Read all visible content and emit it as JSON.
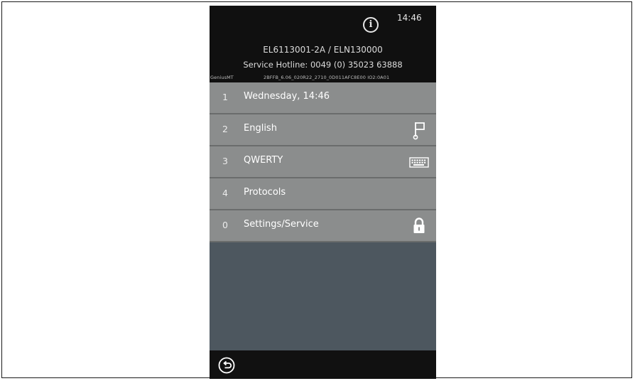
{
  "header": {
    "clock": "14:46",
    "model": "EL6113001-2A / ELN130000",
    "hotline": "Service Hotline: 0049 (0) 35023 63888",
    "device_name": "GeniusMT",
    "firmware": "2BFFB_6.06_020R22_2710_0D011AFC8E00 IO2:0A01",
    "info_icon": "info-icon"
  },
  "menu": {
    "items": [
      {
        "number": "1",
        "label": "Wednesday, 14:46",
        "icon": ""
      },
      {
        "number": "2",
        "label": "English",
        "icon": "flag-icon"
      },
      {
        "number": "3",
        "label": "QWERTY",
        "icon": "keyboard-icon"
      },
      {
        "number": "4",
        "label": "Protocols",
        "icon": ""
      },
      {
        "number": "0",
        "label": "Settings/Service",
        "icon": "lock-icon"
      }
    ]
  },
  "footer": {
    "back_icon": "back-arrow-icon"
  },
  "colors": {
    "menu_background": "#8b8d8d",
    "empty_area": "#4d575f",
    "header_background": "#101010"
  }
}
